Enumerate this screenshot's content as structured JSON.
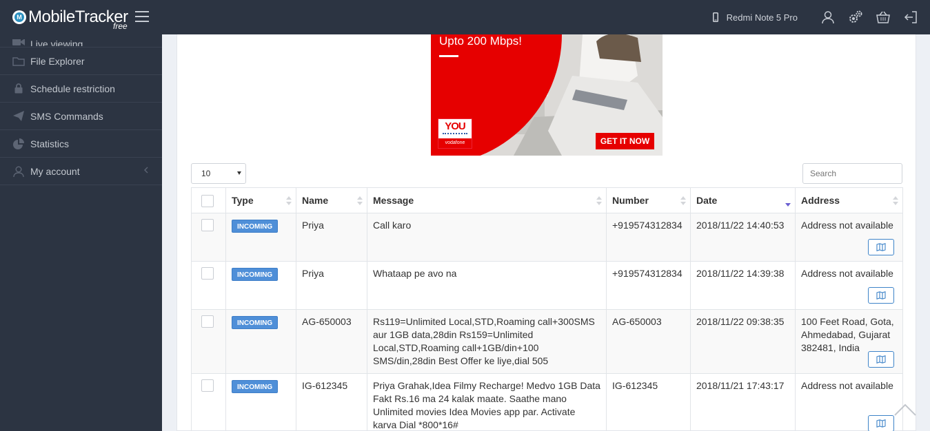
{
  "app": {
    "name": "MobileTracker",
    "edition": "free"
  },
  "header": {
    "device_name": "Redmi Note 5 Pro"
  },
  "sidebar": {
    "items": [
      {
        "label": "Live viewing"
      },
      {
        "label": "File Explorer"
      },
      {
        "label": "Schedule restriction"
      },
      {
        "label": "SMS Commands"
      },
      {
        "label": "Statistics"
      },
      {
        "label": "My account"
      }
    ]
  },
  "ad": {
    "headline": "Upto 200 Mbps!",
    "brand": "YOU",
    "brand_sub": "vodafone",
    "cta": "GET IT NOW"
  },
  "table_controls": {
    "page_length": "10",
    "search_placeholder": "Search"
  },
  "table": {
    "columns": [
      "Type",
      "Name",
      "Message",
      "Number",
      "Date",
      "Address"
    ],
    "rows": [
      {
        "type": "INCOMING",
        "name": "Priya",
        "message": "Call karo",
        "number": "+919574312834",
        "date": "2018/11/22 14:40:53",
        "address": "Address not available"
      },
      {
        "type": "INCOMING",
        "name": "Priya",
        "message": "Whataap pe avo na",
        "number": "+919574312834",
        "date": "2018/11/22 14:39:38",
        "address": "Address not available"
      },
      {
        "type": "INCOMING",
        "name": "AG-650003",
        "message": "Rs119=Unlimited Local,STD,Roaming call+300SMS aur 1GB data,28din Rs159=Unlimited Local,STD,Roaming call+1GB/din+100 SMS/din,28din Best Offer ke liye,dial 505",
        "number": "AG-650003",
        "date": "2018/11/22 09:38:35",
        "address": "100 Feet Road, Gota, Ahmedabad, Gujarat 382481, India"
      },
      {
        "type": "INCOMING",
        "name": "IG-612345",
        "message": "Priya Grahak,Idea Filmy Recharge! Medvo 1GB Data Fakt Rs.16 ma 24 kalak maate. Saathe mano Unlimited movies Idea Movies app par. Activate karva Dial *800*16#",
        "number": "IG-612345",
        "date": "2018/11/21 17:43:17",
        "address": "Address not available"
      }
    ]
  }
}
